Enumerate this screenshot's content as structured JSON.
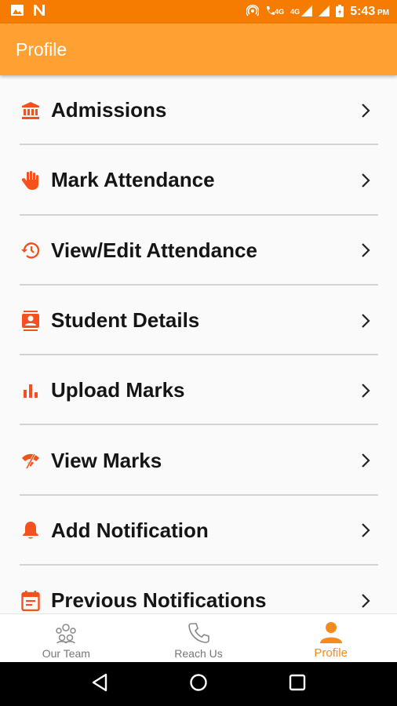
{
  "status_bar": {
    "time": "5:43",
    "ampm": "PM",
    "network_1": "4G",
    "network_2": "4G"
  },
  "app_bar": {
    "title": "Profile"
  },
  "menu": {
    "items": [
      {
        "label": "Admissions",
        "icon": "bank-icon"
      },
      {
        "label": "Mark Attendance",
        "icon": "hand-icon"
      },
      {
        "label": "View/Edit Attendance",
        "icon": "history-icon"
      },
      {
        "label": "Student Details",
        "icon": "contact-card-icon"
      },
      {
        "label": "Upload Marks",
        "icon": "bar-chart-icon"
      },
      {
        "label": "View Marks",
        "icon": "wifi-off-icon"
      },
      {
        "label": "Add Notification",
        "icon": "bell-icon"
      },
      {
        "label": "Previous Notifications",
        "icon": "calendar-note-icon"
      }
    ]
  },
  "bottom_nav": {
    "items": [
      {
        "label": "Our Team",
        "icon": "team-icon"
      },
      {
        "label": "Reach Us",
        "icon": "phone-icon"
      },
      {
        "label": "Profile",
        "icon": "person-icon",
        "active": true
      }
    ]
  },
  "colors": {
    "status_bar": "#f57c00",
    "app_bar": "#ffa033",
    "icon_accent": "#f4511e",
    "active_nav": "#f58b1f"
  }
}
